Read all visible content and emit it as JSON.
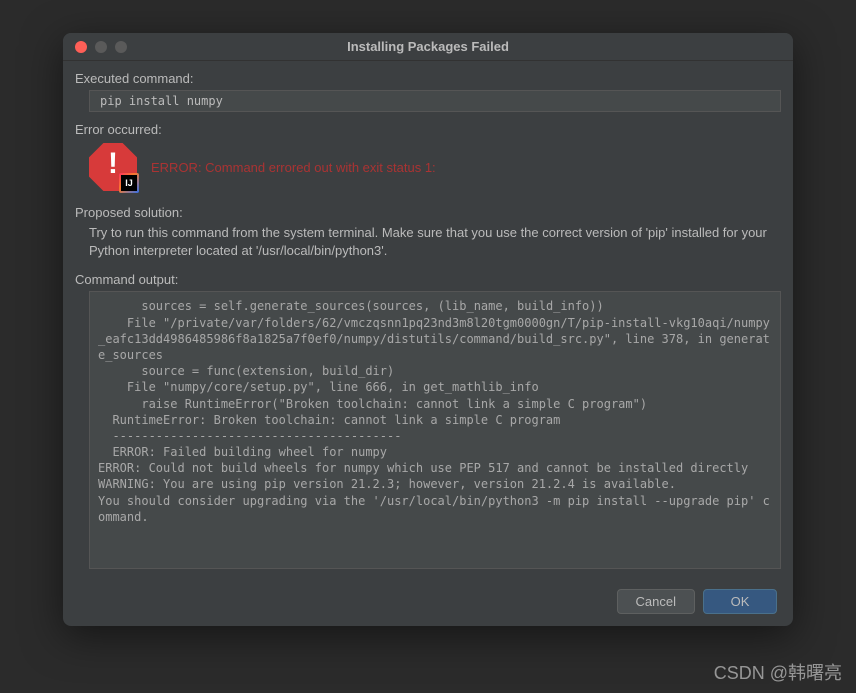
{
  "window": {
    "title": "Installing Packages Failed"
  },
  "labels": {
    "executed_command": "Executed command:",
    "error_occurred": "Error occurred:",
    "proposed_solution": "Proposed solution:",
    "command_output": "Command output:"
  },
  "executed_command": "pip install numpy",
  "error_message": "ERROR: Command errored out with exit status 1:",
  "solution_text": "Try to run this command from the system terminal. Make sure that you use the correct version of 'pip' installed for your Python interpreter located at '/usr/local/bin/python3'.",
  "command_output": "      sources = self.generate_sources(sources, (lib_name, build_info))\n    File \"/private/var/folders/62/vmczqsnn1pq23nd3m8l20tgm0000gn/T/pip-install-vkg10aqi/numpy_eafc13dd4986485986f8a1825a7f0ef0/numpy/distutils/command/build_src.py\", line 378, in generate_sources\n      source = func(extension, build_dir)\n    File \"numpy/core/setup.py\", line 666, in get_mathlib_info\n      raise RuntimeError(\"Broken toolchain: cannot link a simple C program\")\n  RuntimeError: Broken toolchain: cannot link a simple C program\n  ----------------------------------------\n  ERROR: Failed building wheel for numpy\nERROR: Could not build wheels for numpy which use PEP 517 and cannot be installed directly\nWARNING: You are using pip version 21.2.3; however, version 21.2.4 is available.\nYou should consider upgrading via the '/usr/local/bin/python3 -m pip install --upgrade pip' command.",
  "buttons": {
    "cancel": "Cancel",
    "ok": "OK"
  },
  "watermark": "CSDN @韩曙亮"
}
